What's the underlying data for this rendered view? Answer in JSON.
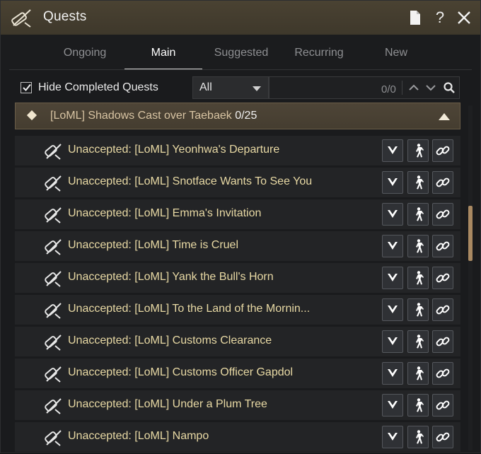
{
  "window": {
    "title": "Quests"
  },
  "titlebar": {
    "help_glyph": "?"
  },
  "tabs": [
    {
      "label": "Ongoing",
      "active": false
    },
    {
      "label": "Main",
      "active": true
    },
    {
      "label": "Suggested",
      "active": false
    },
    {
      "label": "Recurring",
      "active": false
    },
    {
      "label": "New",
      "active": false
    }
  ],
  "filter": {
    "hide_completed_label": "Hide Completed Quests",
    "hide_completed_checked": true,
    "dropdown_value": "All",
    "search_count": "0/0"
  },
  "group": {
    "title": "[LoML] Shadows Cast over Taebaek",
    "count": "0/25"
  },
  "quests": [
    "Unaccepted: [LoML] Yeonhwa's Departure",
    "Unaccepted: [LoML] Snotface Wants To See You",
    "Unaccepted: [LoML] Emma's Invitation",
    "Unaccepted: [LoML] Time is Cruel",
    "Unaccepted: [LoML] Yank the Bull's Horn",
    "Unaccepted: [LoML] To the Land of the Mornin...",
    "Unaccepted: [LoML] Customs Clearance",
    "Unaccepted: [LoML] Customs Officer Gapdol",
    "Unaccepted: [LoML] Under a Plum Tree",
    "Unaccepted: [LoML] Nampo"
  ],
  "icons": {
    "title": "scroll-quill-icon",
    "row": "scroll-quill-icon",
    "actions": [
      "expand-chevron-icon",
      "auto-walk-icon",
      "link-icon"
    ]
  },
  "colors": {
    "titlebar": "#4a4232",
    "group_header": "#4e4537",
    "quest_text": "#e8d9a4",
    "scroll_thumb": "#a98962"
  }
}
